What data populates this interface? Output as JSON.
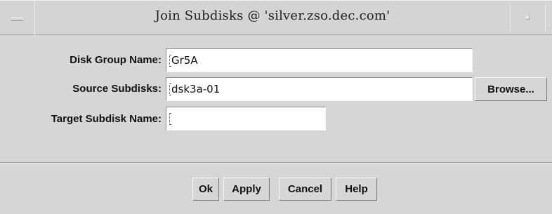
{
  "window": {
    "title": "Join Subdisks @ 'silver.zso.dec.com'",
    "menu_icon": "window-menu-icon",
    "control_icon": "window-control-icon"
  },
  "form": {
    "disk_group": {
      "label": "Disk Group Name:",
      "value": "Gr5A"
    },
    "source_subdisks": {
      "label": "Source Subdisks:",
      "value": "dsk3a-01",
      "browse_label": "Browse..."
    },
    "target_subdisk": {
      "label": "Target Subdisk Name:",
      "value": ""
    }
  },
  "buttons": {
    "ok": "Ok",
    "apply": "Apply",
    "cancel": "Cancel",
    "help": "Help"
  },
  "colors": {
    "background": "#d6d6d6",
    "field": "#ffffff"
  }
}
